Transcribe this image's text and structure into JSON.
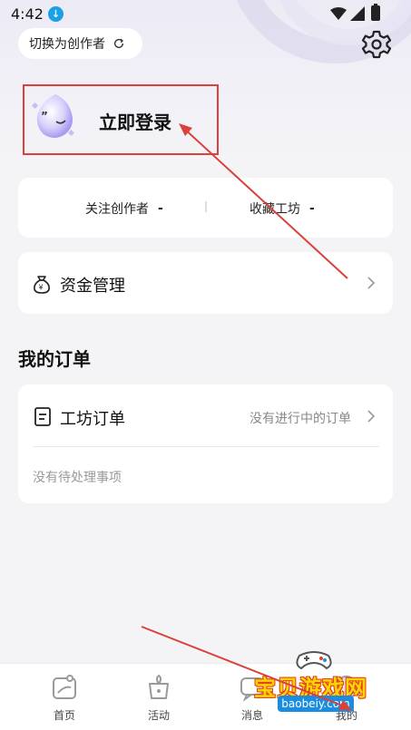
{
  "status_bar": {
    "time": "4:42"
  },
  "header": {
    "switch_label": "切换为创作者"
  },
  "login": {
    "label": "立即登录"
  },
  "follow_card": {
    "followed_creators_label": "关注创作者",
    "followed_creators_value": "-",
    "favorite_workshop_label": "收藏工坊",
    "favorite_workshop_value": "-"
  },
  "funds": {
    "label": "资金管理"
  },
  "orders": {
    "title": "我的订单",
    "workshop_label": "工坊订单",
    "status": "没有进行中的订单",
    "empty": "没有待处理事项"
  },
  "bottom_nav": {
    "items": [
      {
        "label": "首页"
      },
      {
        "label": "活动"
      },
      {
        "label": "消息"
      },
      {
        "label": "我的"
      }
    ]
  },
  "watermark": {
    "title": "宝贝游戏网",
    "url": "baobeiy.com"
  },
  "colors": {
    "annotation_red": "#d9413a",
    "accent_purple": "#b9b1f0"
  }
}
